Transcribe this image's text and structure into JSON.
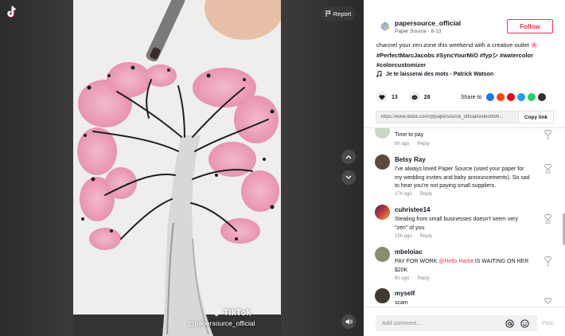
{
  "video": {
    "report_label": "Report",
    "watermark_brand": "TikTok",
    "watermark_handle": "@papersource_official"
  },
  "author": {
    "name": "papersource_official",
    "subtitle": "Paper Source · 8-13",
    "follow_label": "Follow"
  },
  "caption": {
    "text": "channel your zen zone this weekend with a creative outlet 🌸",
    "hashtags": "#PerfectMarcJacobs #SyncYourMiO #fypシ #watercolor",
    "hashtags2": "#colorcustomizer"
  },
  "music": "Je te laisserai des mots - Patrick Watson",
  "stats": {
    "likes": "13",
    "comments": "28",
    "share_label": "Share to"
  },
  "share_icons": [
    {
      "name": "facebook-icon",
      "color": "#1877f2"
    },
    {
      "name": "reddit-icon",
      "color": "#ff4500"
    },
    {
      "name": "pinterest-icon",
      "color": "#e60023"
    },
    {
      "name": "twitter-icon",
      "color": "#1da1f2"
    },
    {
      "name": "whatsapp-icon",
      "color": "#25d366"
    },
    {
      "name": "embed-icon",
      "color": "#2f2f33"
    }
  ],
  "link": {
    "url": "https://www.tiktok.com/@papersource_official/video/699...",
    "copy_label": "Copy link"
  },
  "comments": [
    {
      "name": "",
      "text": "Time to pay",
      "time": "8h ago",
      "reply": "Reply",
      "likes": "2"
    },
    {
      "name": "Betsy Ray",
      "text": "I've always loved Paper Source (used your paper for my wedding invites and baby announcements). So sad to hear you're not paying small suppliers.",
      "time": "17h ago",
      "reply": "Reply",
      "likes": "22"
    },
    {
      "name": "cuhristee14",
      "text": "Stealing from small businesses doesn't seem very \"zen\" of you",
      "time": "15h ago",
      "reply": "Reply",
      "likes": "20"
    },
    {
      "name": "mbeloiac",
      "text_pre": "PAY FOR WORK ",
      "mention": "@Hello Harlot",
      "text_post": " IS WAITING ON HER $20K",
      "time": "6h ago",
      "reply": "Reply",
      "likes": "2"
    },
    {
      "name": "myself",
      "text": "scam",
      "time": "",
      "reply": "",
      "likes": ""
    }
  ],
  "bottom": {
    "placeholder": "Add comment...",
    "post_label": "Post"
  },
  "colors": {
    "accent": "#fe2c55",
    "mention": "#fe2c55"
  }
}
